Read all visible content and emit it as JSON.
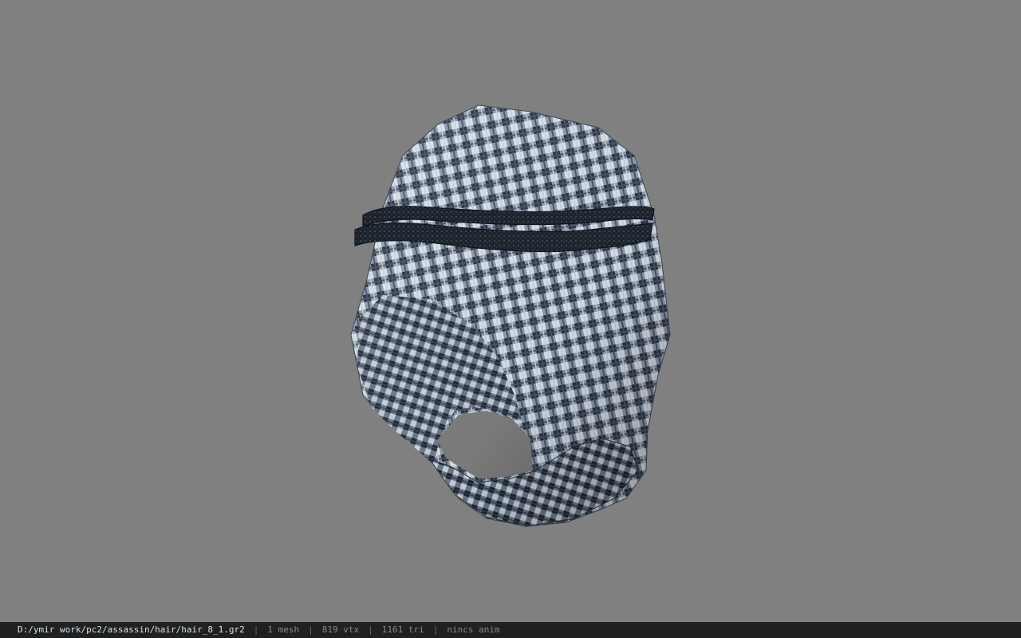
{
  "viewer": {
    "background_color": "#808080",
    "model_icon": "headscarf-agal-model"
  },
  "status_bar": {
    "file_path": "D:/ymir work/pc2/assassin/hair/hair_8_1.gr2",
    "mesh_count": "1 mesh",
    "vertex_count": "819 vtx",
    "triangle_count": "1161 tri",
    "anim_status": "nincs anim",
    "separator": "|"
  }
}
